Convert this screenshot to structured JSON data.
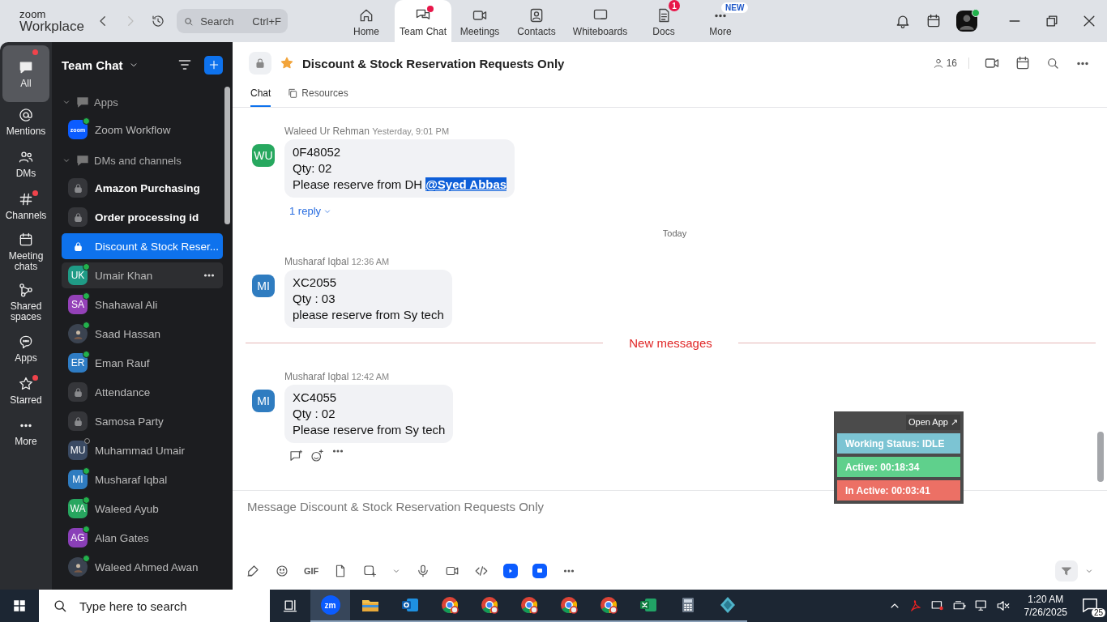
{
  "app_bar": {
    "logo": {
      "top": "zoom",
      "bottom": "Workplace"
    },
    "search": {
      "placeholder": "Search",
      "shortcut": "Ctrl+F"
    },
    "nav": [
      {
        "kind": "home",
        "label": "Home",
        "selected": false,
        "unread": false
      },
      {
        "kind": "chat",
        "label": "Team Chat",
        "selected": true,
        "unread": true
      },
      {
        "kind": "meetings",
        "label": "Meetings",
        "selected": false,
        "unread": false
      },
      {
        "kind": "contacts",
        "label": "Contacts",
        "selected": false,
        "unread": false
      },
      {
        "kind": "whiteboards",
        "label": "Whiteboards",
        "selected": false,
        "unread": false
      },
      {
        "kind": "docs",
        "label": "Docs",
        "selected": false,
        "unread": false,
        "badge": {
          "kind": "count",
          "text": "1"
        }
      },
      {
        "kind": "more",
        "label": "More",
        "selected": false,
        "unread": false,
        "badge": {
          "kind": "new",
          "text": "NEW"
        }
      }
    ],
    "profile": {
      "online": true
    }
  },
  "rail": [
    {
      "kind": "all",
      "label": "All",
      "selected": true,
      "unread": true
    },
    {
      "kind": "mentions",
      "label": "Mentions",
      "selected": false,
      "unread": false
    },
    {
      "kind": "dms",
      "label": "DMs",
      "selected": false,
      "unread": false
    },
    {
      "kind": "channels",
      "label": "Channels",
      "selected": false,
      "unread": true
    },
    {
      "kind": "meeting_chats",
      "label": "Meeting chats",
      "selected": false,
      "unread": false
    },
    {
      "kind": "shared_spaces",
      "label": "Shared spaces",
      "selected": false,
      "unread": false
    },
    {
      "kind": "apps",
      "label": "Apps",
      "selected": false,
      "unread": false
    },
    {
      "kind": "starred",
      "label": "Starred",
      "selected": false,
      "unread": true
    },
    {
      "kind": "more",
      "label": "More",
      "selected": false,
      "unread": false
    }
  ],
  "sidebar": {
    "title": "Team Chat",
    "sections": [
      {
        "label": "Apps",
        "expanded": true,
        "items": [
          {
            "kind": "app",
            "label": "Zoom Workflow",
            "logo_text": "zoom",
            "online": true,
            "bold": false,
            "selected": false,
            "hovered": false
          }
        ]
      },
      {
        "label": "DMs and channels",
        "expanded": true,
        "items": [
          {
            "kind": "channel",
            "label": "Amazon Purchasing",
            "bold": true,
            "selected": false,
            "hovered": false
          },
          {
            "kind": "channel",
            "label": "Order processing id",
            "bold": true,
            "selected": false,
            "hovered": false
          },
          {
            "kind": "channel",
            "label": "Discount & Stock Reser...",
            "bold": false,
            "selected": true,
            "hovered": false
          },
          {
            "kind": "person",
            "label": "Umair Khan",
            "initials": "UK",
            "color": "#1f9b86",
            "online": true,
            "bold": false,
            "selected": false,
            "hovered": true
          },
          {
            "kind": "person",
            "label": "Shahawal Ali",
            "initials": "SA",
            "color": "#9441b8",
            "online": true,
            "bold": false,
            "selected": false,
            "hovered": false
          },
          {
            "kind": "person",
            "label": "Saad Hassan",
            "online": true,
            "bold": false,
            "selected": false,
            "hovered": false
          },
          {
            "kind": "person",
            "label": "Eman Rauf",
            "initials": "ER",
            "color": "#2e7cc4",
            "online": true,
            "bold": false,
            "selected": false,
            "hovered": false
          },
          {
            "kind": "channel",
            "label": "Attendance",
            "bold": false,
            "selected": false,
            "hovered": false
          },
          {
            "kind": "channel",
            "label": "Samosa Party",
            "bold": false,
            "selected": false,
            "hovered": false
          },
          {
            "kind": "person",
            "label": "Muhammad Umair",
            "initials": "MU",
            "color": "#3a4a63",
            "online": false,
            "bold": false,
            "selected": false,
            "hovered": false
          },
          {
            "kind": "person",
            "label": "Musharaf Iqbal",
            "initials": "MI",
            "color": "#2f7cc0",
            "online": true,
            "bold": false,
            "selected": false,
            "hovered": false
          },
          {
            "kind": "person",
            "label": "Waleed Ayub",
            "initials": "WA",
            "color": "#27a65f",
            "online": true,
            "bold": false,
            "selected": false,
            "hovered": false
          },
          {
            "kind": "person",
            "label": "Alan Gates",
            "initials": "AG",
            "color": "#8a3fb8",
            "online": true,
            "bold": false,
            "selected": false,
            "hovered": false
          },
          {
            "kind": "person",
            "label": "Waleed Ahmed Awan",
            "online": true,
            "bold": false,
            "selected": false,
            "hovered": false
          }
        ]
      }
    ]
  },
  "chat": {
    "header": {
      "title": "Discount & Stock Reservation Requests Only",
      "private": true,
      "starred": true,
      "members": "16"
    },
    "tabs": [
      {
        "label": "Chat",
        "selected": true
      },
      {
        "label": "Resources",
        "selected": false
      }
    ],
    "timeline": [
      {
        "kind": "message",
        "author": "Waleed Ur Rehman",
        "time": "Yesterday, 9:01 PM",
        "initials": "WU",
        "color": "#27a85f",
        "lines": [
          "0F48052",
          "Qty: 02",
          "Please reserve from DH **@Syed Abbas**"
        ],
        "replies": "1 reply",
        "actions_shown": false
      },
      {
        "kind": "date",
        "text": "Today"
      },
      {
        "kind": "message",
        "author": "Musharaf Iqbal",
        "time": "12:36 AM",
        "initials": "MI",
        "color": "#2f7cc0",
        "lines": [
          "XC2055",
          "Qty : 03",
          "please reserve from Sy tech"
        ],
        "actions_shown": false
      },
      {
        "kind": "new_messages",
        "text": "New messages"
      },
      {
        "kind": "message",
        "author": "Musharaf Iqbal",
        "time": "12:42 AM",
        "initials": "MI",
        "color": "#2f7cc0",
        "lines": [
          "XC4055",
          "Qty : 02",
          "Please reserve from Sy tech"
        ],
        "actions_shown": true
      }
    ],
    "composer": {
      "placeholder": "Message Discount & Stock Reservation Requests Only",
      "gif_label": "GIF"
    }
  },
  "widget": {
    "open_label": "Open App ↗",
    "rows": [
      {
        "text": "Working Status: IDLE",
        "color": "#7cc4d3"
      },
      {
        "text": "Active: 00:18:34",
        "color": "#5fd08c"
      },
      {
        "text": "In Active: 00:03:41",
        "color": "#ec7065"
      }
    ]
  },
  "taskbar": {
    "search_placeholder": "Type here to search",
    "zoom_label": "zm",
    "apps": [
      {
        "kind": "zoom",
        "selected": true
      },
      {
        "kind": "folder",
        "selected": false
      },
      {
        "kind": "mail",
        "selected": false
      },
      {
        "kind": "browser",
        "selected": false
      },
      {
        "kind": "browser",
        "selected": false
      },
      {
        "kind": "browser",
        "selected": false
      },
      {
        "kind": "browser",
        "selected": false
      },
      {
        "kind": "browser",
        "selected": false
      },
      {
        "kind": "spreadsheet",
        "selected": false
      },
      {
        "kind": "calculator",
        "selected": false
      },
      {
        "kind": "app",
        "selected": false
      }
    ],
    "time": "1:20 AM",
    "date": "7/26/2025",
    "notifications": "25"
  }
}
